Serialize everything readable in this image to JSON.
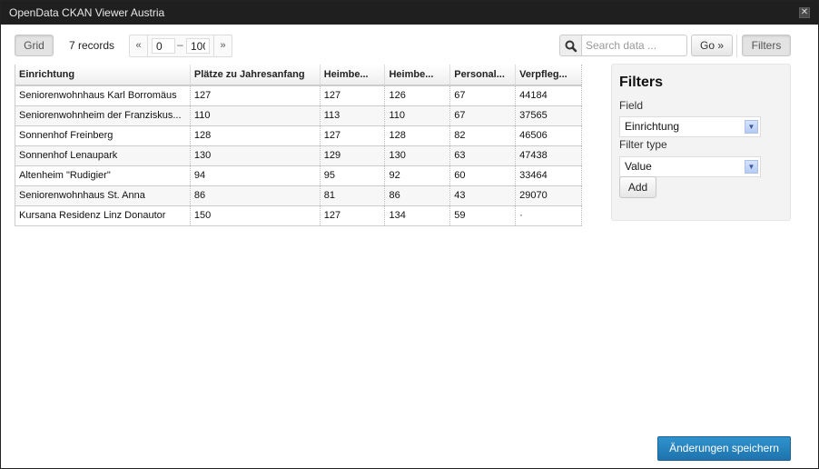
{
  "window": {
    "title": "OpenData CKAN Viewer Austria",
    "close_icon": "close-icon"
  },
  "toolbar": {
    "grid_label": "Grid",
    "records_label": "7 records",
    "pager": {
      "prev_label": "«",
      "next_label": "»",
      "from": "0",
      "to": "100",
      "dash": "–"
    },
    "search": {
      "icon": "search-icon",
      "placeholder": "Search data ...",
      "value": ""
    },
    "go_label": "Go »",
    "filters_label": "Filters"
  },
  "grid": {
    "columns": [
      "Einrichtung",
      "Plätze zu Jahresanfang",
      "Heimbe...",
      "Heimbe...",
      "Personal...",
      "Verpfleg..."
    ],
    "rows": [
      [
        "Seniorenwohnhaus Karl Borromäus",
        "127",
        "127",
        "126",
        "67",
        "44184"
      ],
      [
        "Seniorenwohnheim der Franziskus...",
        "110",
        "113",
        "110",
        "67",
        "37565"
      ],
      [
        "Sonnenhof Freinberg",
        "128",
        "127",
        "128",
        "82",
        "46506"
      ],
      [
        "Sonnenhof Lenaupark",
        "130",
        "129",
        "130",
        "63",
        "47438"
      ],
      [
        "Altenheim \"Rudigier\"",
        "94",
        "95",
        "92",
        "60",
        "33464"
      ],
      [
        "Seniorenwohnhaus St. Anna",
        "86",
        "81",
        "86",
        "43",
        "29070"
      ],
      [
        "Kursana Residenz Linz Donautor",
        "150",
        "127",
        "134",
        "59",
        "·"
      ]
    ]
  },
  "filters": {
    "title": "Filters",
    "field_label": "Field",
    "field_value": "Einrichtung",
    "filter_type_label": "Filter type",
    "filter_type_value": "Value",
    "add_label": "Add"
  },
  "footer": {
    "save_label": "Änderungen speichern"
  },
  "colors": {
    "titlebar": "#1f1f1f",
    "primary_button": "#2683bd"
  }
}
